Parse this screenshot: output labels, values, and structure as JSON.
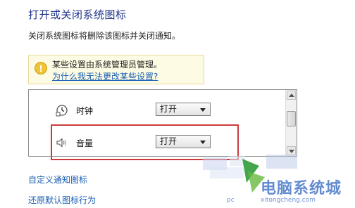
{
  "page": {
    "title": "打开或关闭系统图标",
    "description": "关闭系统图标将删除该图标并关闭通知。"
  },
  "info": {
    "text": "某些设置由系统管理员管理。",
    "link": "为什么我无法更改某些设置?"
  },
  "icons_list": [
    {
      "name": "时钟",
      "icon": "clock-icon",
      "value": "打开"
    },
    {
      "name": "音量",
      "icon": "speaker-icon",
      "value": "打开"
    }
  ],
  "links": {
    "customize": "自定义通知图标",
    "restore": "还原默认图标行为"
  },
  "watermark": {
    "brand": "电脑系统城",
    "prefix": "pc",
    "url": "xitongcheng.com"
  },
  "colors": {
    "title": "#1e3287",
    "link": "#1a5fb4",
    "highlight": "#cf3b3b",
    "info_bg": "#fdfbe3"
  }
}
